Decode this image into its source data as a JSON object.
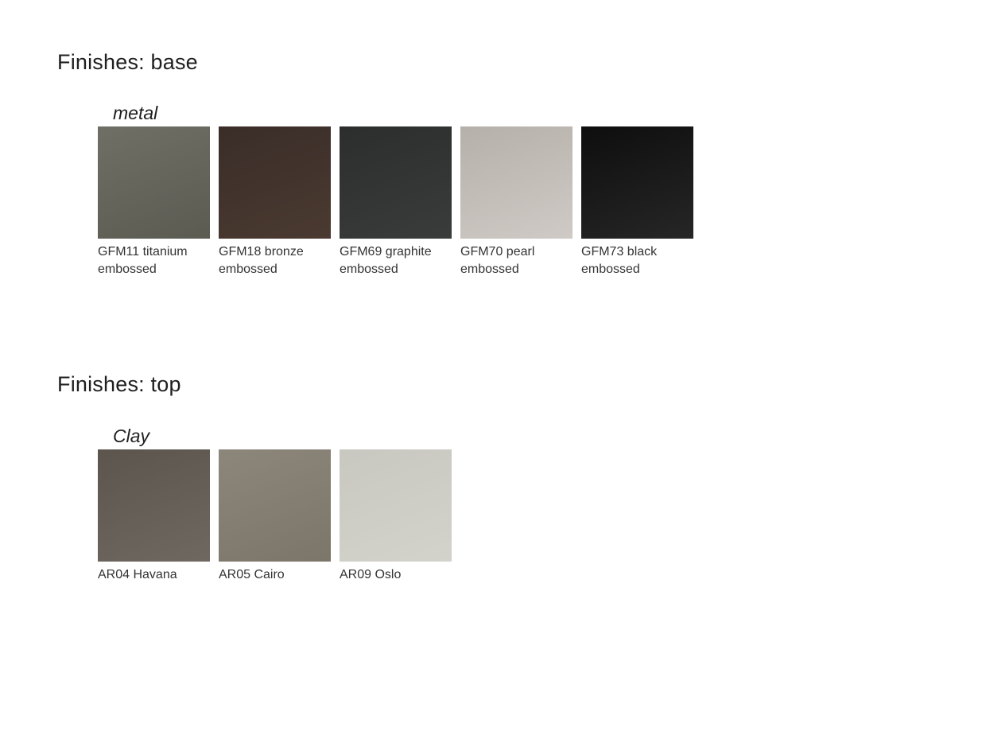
{
  "sections": [
    {
      "title": "Finishes: base",
      "group_label": "metal",
      "swatches": [
        {
          "code": "GFM11 titanium",
          "finish": "embossed",
          "color_top": "#6f6f66",
          "color_bottom": "#5b5b52"
        },
        {
          "code": "GFM18 bronze",
          "finish": "embossed",
          "color_top": "#3a2d28",
          "color_bottom": "#4a3a31"
        },
        {
          "code": "GFM69 graphite",
          "finish": "embossed",
          "color_top": "#2c2e2e",
          "color_bottom": "#3a3c3c"
        },
        {
          "code": "GFM70 pearl",
          "finish": "embossed",
          "color_top": "#b5b0aa",
          "color_bottom": "#cfcac5"
        },
        {
          "code": "GFM73 black",
          "finish": "embossed",
          "color_top": "#0e0e0e",
          "color_bottom": "#262626"
        }
      ]
    },
    {
      "title": "Finishes: top",
      "group_label": "Clay",
      "swatches": [
        {
          "code": "AR04 Havana",
          "finish": "",
          "color_top": "#5c554d",
          "color_bottom": "#6e6861"
        },
        {
          "code": "AR05 Cairo",
          "finish": "",
          "color_top": "#8d877b",
          "color_bottom": "#7c766a"
        },
        {
          "code": "AR09 Oslo",
          "finish": "",
          "color_top": "#c9c8c0",
          "color_bottom": "#d3d2cb"
        }
      ]
    }
  ]
}
